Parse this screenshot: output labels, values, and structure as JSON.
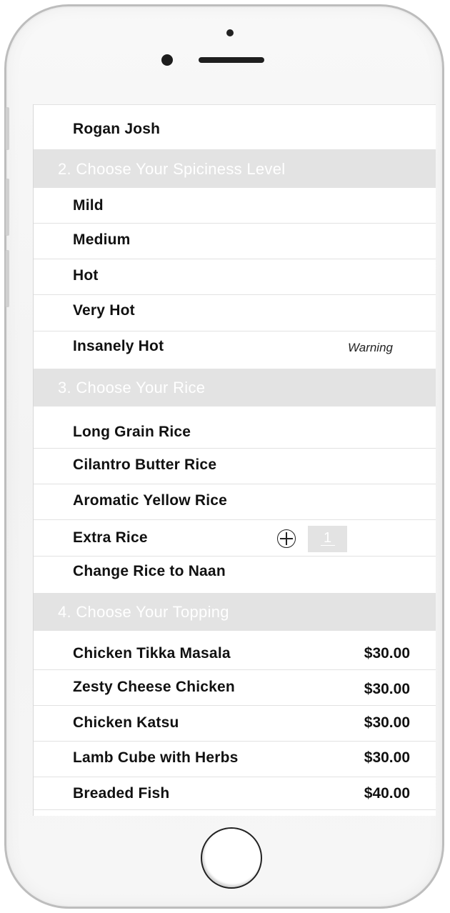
{
  "items_top": [
    {
      "label": "Rogan Josh"
    }
  ],
  "sections": {
    "spiciness": {
      "title": "2. Choose Your Spiciness Level",
      "options": [
        {
          "label": "Mild"
        },
        {
          "label": "Medium"
        },
        {
          "label": "Hot"
        },
        {
          "label": "Very Hot"
        },
        {
          "label": "Insanely Hot",
          "note": "Warning"
        }
      ]
    },
    "rice": {
      "title": "3. Choose Your Rice",
      "options": [
        {
          "label": "Long Grain Rice"
        },
        {
          "label": "Cilantro Butter Rice"
        },
        {
          "label": "Aromatic Yellow Rice"
        },
        {
          "label": "Extra Rice",
          "quantity": "1"
        },
        {
          "label": "Change Rice to Naan"
        }
      ]
    },
    "topping": {
      "title": "4. Choose Your Topping",
      "options": [
        {
          "label": "Chicken Tikka Masala",
          "price": "$30.00"
        },
        {
          "label": "Zesty Cheese Chicken",
          "price": "$30.00"
        },
        {
          "label": "Chicken Katsu",
          "price": "$30.00"
        },
        {
          "label": "Lamb Cube with Herbs",
          "price": "$30.00"
        },
        {
          "label": "Breaded Fish",
          "price": "$40.00"
        }
      ]
    }
  },
  "icons": {
    "add_quantity": "plus-circle-icon"
  },
  "colors": {
    "section_header_bg": "#e3e3e3",
    "section_header_text": "#ffffff",
    "item_text": "#111111",
    "divider": "#e2e2e2"
  }
}
